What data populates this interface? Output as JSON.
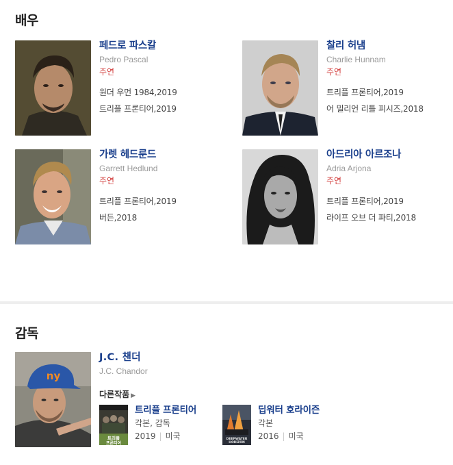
{
  "actors_section": {
    "title": "배우",
    "cast": [
      {
        "name_ko": "페드로 파스칼",
        "name_en": "Pedro Pascal",
        "role": "주연",
        "works": [
          "원더 우먼 1984,2019",
          "트리플 프론티어,2019"
        ]
      },
      {
        "name_ko": "찰리 허냄",
        "name_en": "Charlie Hunnam",
        "role": "주연",
        "works": [
          "트리플 프론티어,2019",
          "어 밀리언 리틀 피시즈,2018"
        ]
      },
      {
        "name_ko": "가렛 헤드룬드",
        "name_en": "Garrett Hedlund",
        "role": "주연",
        "works": [
          "트리플 프론티어,2019",
          "버든,2018"
        ]
      },
      {
        "name_ko": "아드리아 아르조나",
        "name_en": "Adria Arjona",
        "role": "주연",
        "works": [
          "트리플 프론티어,2019",
          "라이프 오브 더 파티,2018"
        ]
      }
    ]
  },
  "director_section": {
    "title": "감독",
    "director": {
      "name_ko": "J.C. 챈더",
      "name_en": "J.C. Chandor",
      "other_works_label": "다른작품",
      "films": [
        {
          "title": "트리플 프론티어",
          "role": "각본, 감독",
          "year": "2019",
          "country": "미국",
          "poster_text": "트리플 프론티어"
        },
        {
          "title": "딥워터 호라이즌",
          "role": "각본",
          "year": "2016",
          "country": "미국",
          "poster_text": "DEEPWATER HORIZON"
        }
      ]
    }
  },
  "colors": {
    "link": "#1a3f8c",
    "role": "#d3403f",
    "subtext": "#9a9a9a"
  }
}
